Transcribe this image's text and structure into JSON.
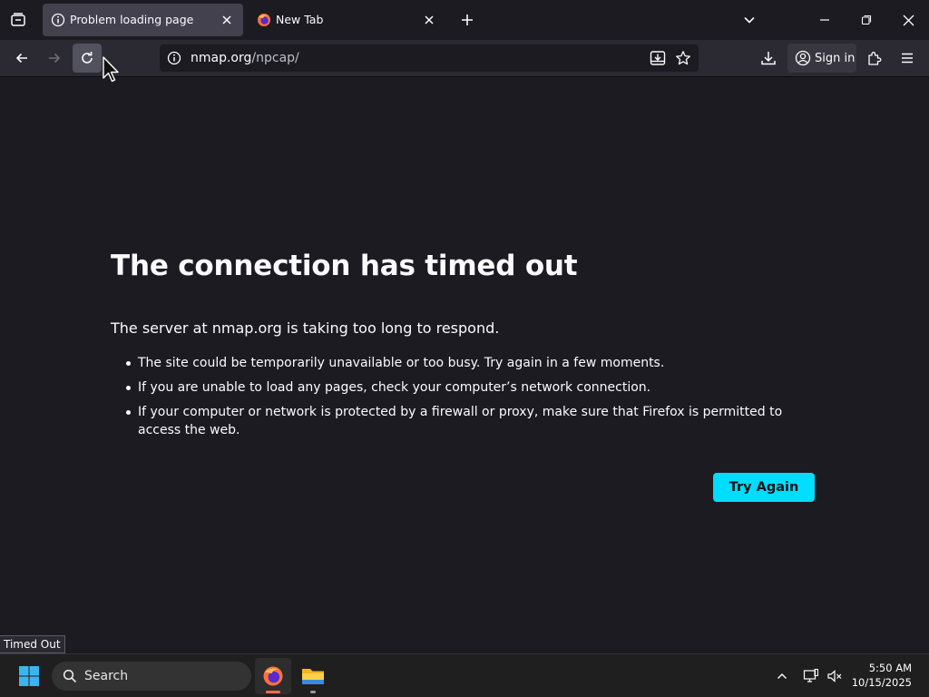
{
  "tabs": [
    {
      "title": "Problem loading page",
      "icon": "info-icon",
      "active": true
    },
    {
      "title": "New Tab",
      "icon": "firefox-icon",
      "active": false
    }
  ],
  "toolbar": {
    "url_host": "nmap.org",
    "url_path": "/npcap/",
    "signin_label": "Sign in"
  },
  "error": {
    "title": "The connection has timed out",
    "description": "The server at nmap.org is taking too long to respond.",
    "items": [
      "The site could be temporarily unavailable or too busy. Try again in a few moments.",
      "If you are unable to load any pages, check your computer’s network connection.",
      "If your computer or network is protected by a firewall or proxy, make sure that Firefox is permitted to access the web."
    ],
    "button_label": "Try Again"
  },
  "status_tooltip": "Timed Out",
  "taskbar": {
    "search_label": "Search",
    "time": "5:50 AM",
    "date": "10/15/2025"
  },
  "colors": {
    "accent": "#00ddff",
    "page_bg": "#1c1b22",
    "toolbar_bg": "#2b2a33"
  }
}
